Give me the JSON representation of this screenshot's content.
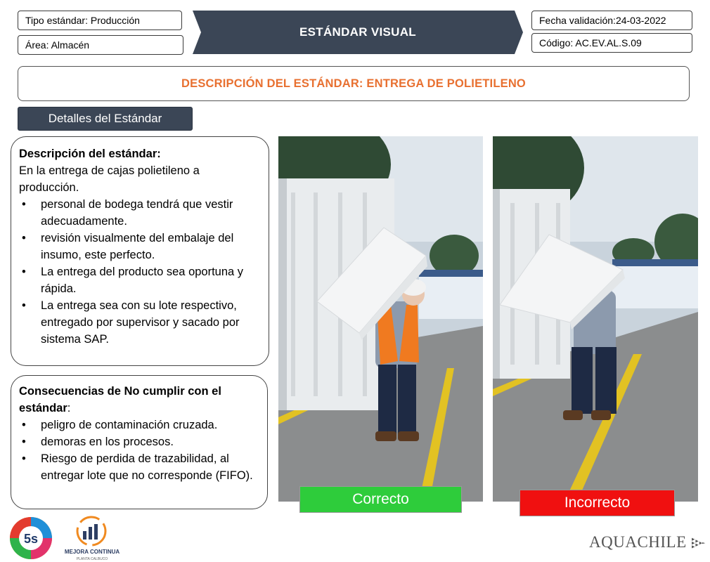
{
  "header": {
    "tipo": "Tipo estándar: Producción",
    "area": "Área: Almacén",
    "banner": "ESTÁNDAR VISUAL",
    "fecha": "Fecha validación:24-03-2022",
    "codigo": "Código: AC.EV.AL.S.09",
    "banner_color": "#3b4656"
  },
  "title": {
    "text": "DESCRIPCIÓN DEL ESTÁNDAR: ENTREGA DE POLIETILENO",
    "color": "#e87030"
  },
  "detalles_label": "Detalles del Estándar",
  "descripcion": {
    "heading": "Descripción del estándar:",
    "intro": "En la entrega de cajas polietileno a producción.",
    "items": [
      "personal de bodega tendrá que vestir adecuadamente.",
      "revisión visualmente del embalaje del insumo, este perfecto.",
      "La entrega del producto sea oportuna y rápida.",
      "La entrega sea con su lote respectivo, entregado por supervisor y sacado por sistema SAP."
    ]
  },
  "consecuencias": {
    "heading": "Consecuencias de No cumplir con el estándar",
    "colon": ":",
    "items": [
      "peligro de contaminación cruzada.",
      "demoras en los procesos.",
      "Riesgo de perdida de trazabilidad, al entregar lote que no corresponde (FIFO)."
    ]
  },
  "photos": {
    "correct_label": "Correcto",
    "incorrect_label": "Incorrecto",
    "correct_color": "#2ecc3b",
    "incorrect_color": "#f01010"
  },
  "logos": {
    "five_s": "5s",
    "mejora": "MEJORA CONTINUA",
    "mejora_sub": "PLANTA CALBUCO",
    "aquachile": "AQUACHILE"
  }
}
